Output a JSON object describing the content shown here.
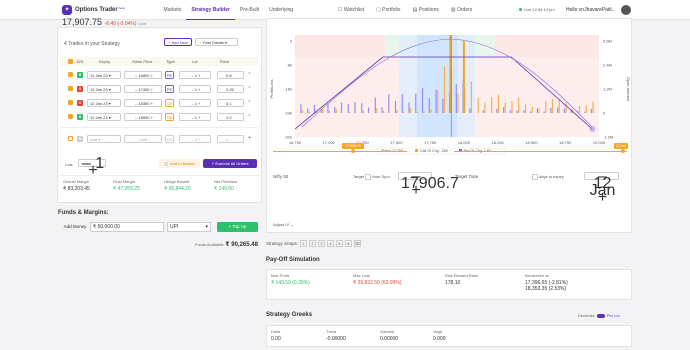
{
  "brand": {
    "name": "Options Trader",
    "beta": "beta"
  },
  "nav": {
    "markets": "Markets",
    "strategy_builder": "Strategy Builder",
    "prebuilt": "Pre-Built",
    "underlying": "Underlying"
  },
  "rnav": {
    "watchlist": "Watchlist",
    "portfolio": "Portfolio",
    "positions": "Positions",
    "orders": "Orders"
  },
  "live": {
    "label": "Live",
    "time": "12:34:14 pm"
  },
  "user": {
    "greeting": "Hello vnJhavarePatil.."
  },
  "ticker": {
    "price": "17,907.75",
    "change": "-6.40 (-0.04%)",
    "tag": "Live"
  },
  "strategy": {
    "trades_count": "4 Trades in your Strategy",
    "add_new": "+ Add New",
    "fast_create": "Fast Create"
  },
  "table_head": {
    "bs": "B/S",
    "expiry": "Expiry",
    "strike": "Strike Price",
    "type": "Type",
    "lot": "Lot",
    "price": "Price"
  },
  "rows": [
    {
      "bs": "B",
      "expiry": "12 Jan 23",
      "strike": "16800",
      "type": "PE",
      "lot": "1",
      "price": "0.8"
    },
    {
      "bs": "S",
      "expiry": "12 Jan 23",
      "strike": "17400",
      "type": "PE",
      "lot": "1",
      "price": "2.25"
    },
    {
      "bs": "S",
      "expiry": "12 Jan 23",
      "strike": "18350",
      "type": "CE",
      "lot": "1",
      "price": "3.1"
    },
    {
      "bs": "B",
      "expiry": "12 Jan 23",
      "strike": "18950",
      "type": "CE",
      "lot": "1",
      "price": "1.2"
    },
    {
      "bs": "B",
      "expiry": "Add",
      "strike": "Add",
      "type": "CE",
      "lot": "0",
      "price": "0"
    }
  ],
  "lots": {
    "label": "Lots",
    "value": "1"
  },
  "buttons": {
    "add_basket": "Add to Basket",
    "execute": "Execute All Orders"
  },
  "margins": {
    "overall": {
      "label": "Overall Margin",
      "value": "₹ 83,203.45"
    },
    "final": {
      "label": "Final Margin",
      "value": "₹ 47,359.25"
    },
    "hedge": {
      "label": "Hedge Benefit",
      "value": "₹ 35,844.20"
    },
    "premium": {
      "label": "Net Premium",
      "value": "₹ 149.50"
    }
  },
  "funds": {
    "title": "Funds & Margins:",
    "add_money": "Add Money",
    "amount": "₹ 50,000.00",
    "method": "UPI",
    "topup": "+ Top Up",
    "available_label": "Funds Available:",
    "available": "₹ 90,265.48"
  },
  "chart": {
    "y_left_ticks": [
      "0",
      "-8k",
      "-16k",
      "-24k",
      "-32k"
    ],
    "y_right_ticks": [
      "3.6M",
      "2.4M",
      "1.2M",
      "0",
      "-1.2M"
    ],
    "x_ticks": [
      "16,750",
      "17,000",
      "17,250",
      "17,500",
      "17,750",
      "18,000",
      "18,250",
      "18,500",
      "18,750",
      "19,000"
    ],
    "y_left_label": "Profit/Loss",
    "y_right_label": "Open Interest",
    "legend_strike": "Strike: 17,200",
    "legend_call": "Call OI Chg: -250",
    "legend_put": "Put OI Chg: 7.91L"
  },
  "chart_data": {
    "type": "bar",
    "x_range": [
      16750,
      19000
    ],
    "series": [
      {
        "name": "Call OI Chg",
        "color": "#f5a623"
      },
      {
        "name": "Put OI Chg",
        "color": "#7b61ff"
      }
    ]
  },
  "controls": {
    "spot_badge": "17,906.75",
    "date_badge": "12 Jan",
    "nifty_label": "Nifty 50",
    "target_label": "Target",
    "from_spot_label": "from Spot",
    "target_value": "17906.7",
    "target_date_label": "Target Date",
    "days_label": "days to expiry",
    "date_value": "12 Jan",
    "adjust_iv": "Adjust IV"
  },
  "snapshots": {
    "label": "Strategy Snaps:",
    "items": [
      "1",
      "2",
      "3",
      "4",
      "5",
      "6"
    ]
  },
  "payoff": {
    "title": "Pay-Off Simulation",
    "max_profit_label": "Max Profit",
    "max_profit": "₹ 149.50 (0.35%)",
    "max_loss_label": "Max Loss",
    "max_loss": "₹ 29,832.50 (62.99%)",
    "rr_label": "Risk Reward Ratio",
    "rr": "178.10",
    "be_label": "Breakeven at",
    "be1": "17,396.65 (-2.81%)",
    "be2": "18,353.35 (2.53%)"
  },
  "greeks": {
    "title": "Strategy Greeks",
    "toggle_left": "Decimals",
    "toggle_right": "Per Lot",
    "delta_label": "Delta",
    "delta": "0.00",
    "theta_label": "Theta",
    "theta": "-0.00000",
    "gamma_label": "Gamma",
    "gamma": "0.00000",
    "vega_label": "Vega",
    "vega": "0.000"
  }
}
